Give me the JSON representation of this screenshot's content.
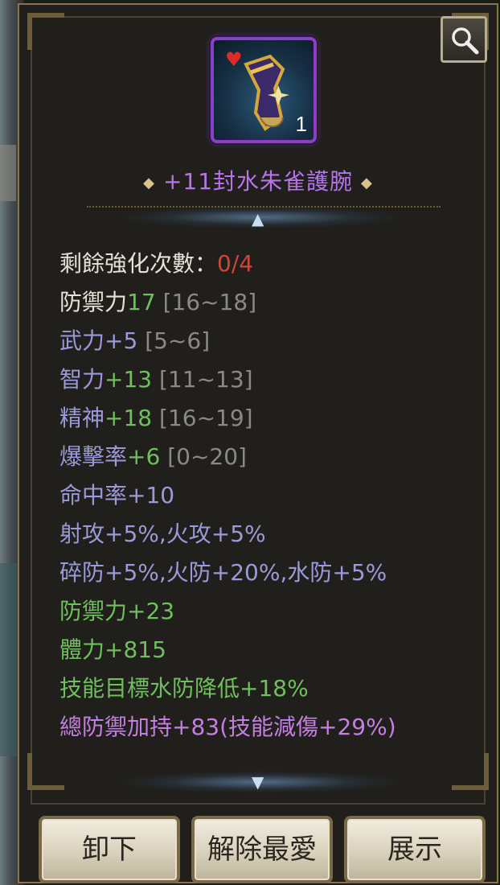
{
  "item": {
    "name": "+11封水朱雀護腕",
    "stack_count": "1",
    "rarity_color": "#8a3fc6"
  },
  "stats": {
    "enhance_label": "剩餘強化次數：",
    "enhance_value": "0/4",
    "defense_label": "防禦力",
    "defense_value": "17",
    "defense_range": "[16~18]",
    "force_label": "武力+5",
    "force_range": "[5~6]",
    "int_label": "智力",
    "int_value": "+13",
    "int_range": "[11~13]",
    "spirit_label": "精神",
    "spirit_value": "+18",
    "spirit_range": "[16~19]",
    "crit_label": "爆擊率",
    "crit_value": "+6",
    "crit_range": "[0~20]",
    "hit_line": "命中率+10",
    "attack_line": "射攻+5%,火攻+5%",
    "resist_line": "碎防+5%,火防+20%,水防+5%",
    "bonus_defense_line": "防禦力+23",
    "bonus_vitality_line": "體力+815",
    "skill_line": "技能目標水防降低+18%",
    "set_line": "總防禦加持+83(技能減傷+29%)"
  },
  "buttons": {
    "unequip": "卸下",
    "unfavorite": "解除最愛",
    "showcase": "展示"
  },
  "icons": {
    "magnifier": "magnifier-icon",
    "heart": "heart-icon",
    "arrow_up": "arrow-up-icon",
    "arrow_down": "arrow-down-icon"
  },
  "colors": {
    "panel_bg": "#201f1b",
    "frame_gold": "#8a7448",
    "stat_green": "#6fbf5e",
    "stat_red": "#d0453c",
    "stat_bluepurple": "#9b9ad8",
    "set_purple": "#c47fe0"
  }
}
